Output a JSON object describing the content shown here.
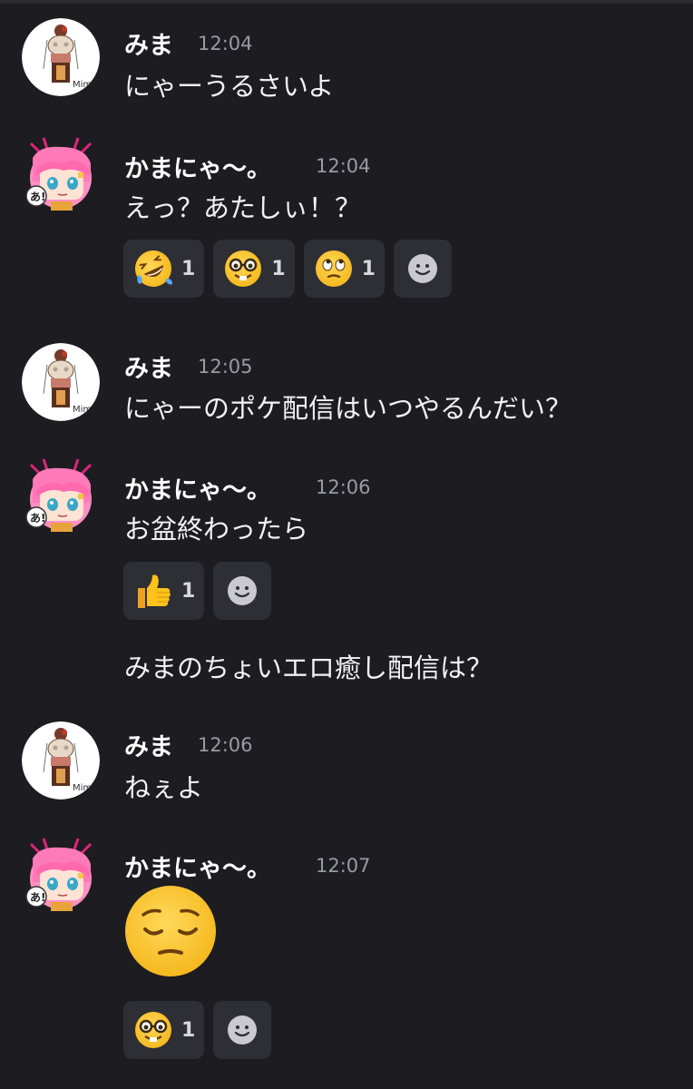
{
  "messages": [
    {
      "user": "みま",
      "time": "12:04",
      "text": "にゃーうるさいよ",
      "avatar": "mima-avatar"
    },
    {
      "user": "かまにゃ〜。",
      "time": "12:04",
      "text": "えっ？あたしぃ！？",
      "avatar": "kamanya-avatar",
      "reactions": [
        {
          "emoji": "rofl-emoji",
          "count": "1"
        },
        {
          "emoji": "nerd-face-emoji",
          "count": "1"
        },
        {
          "emoji": "face-with-rolling-eyes-emoji",
          "count": "1"
        }
      ]
    },
    {
      "user": "みま",
      "time": "12:05",
      "text": "にゃーのポケ配信はいつやるんだい？",
      "avatar": "mima-avatar"
    },
    {
      "user": "かまにゃ〜。",
      "time": "12:06",
      "text": "お盆終わったら",
      "avatar": "kamanya-avatar",
      "reactions": [
        {
          "emoji": "thumbs-up-emoji",
          "count": "1"
        }
      ],
      "followup": "みまのちょいエロ癒し配信は？"
    },
    {
      "user": "みま",
      "time": "12:06",
      "text": "ねぇよ",
      "avatar": "mima-avatar"
    },
    {
      "user": "かまにゃ〜。",
      "time": "12:07",
      "big_emoji": "pensive-face-emoji",
      "avatar": "kamanya-avatar",
      "reactions": [
        {
          "emoji": "nerd-face-emoji",
          "count": "1"
        }
      ]
    }
  ],
  "add_reaction_icon": "smiley-add-reaction-icon",
  "colors": {
    "background": "#1c1c21",
    "reaction_bg": "#2e2e35",
    "timestamp": "#9a9aa2"
  }
}
